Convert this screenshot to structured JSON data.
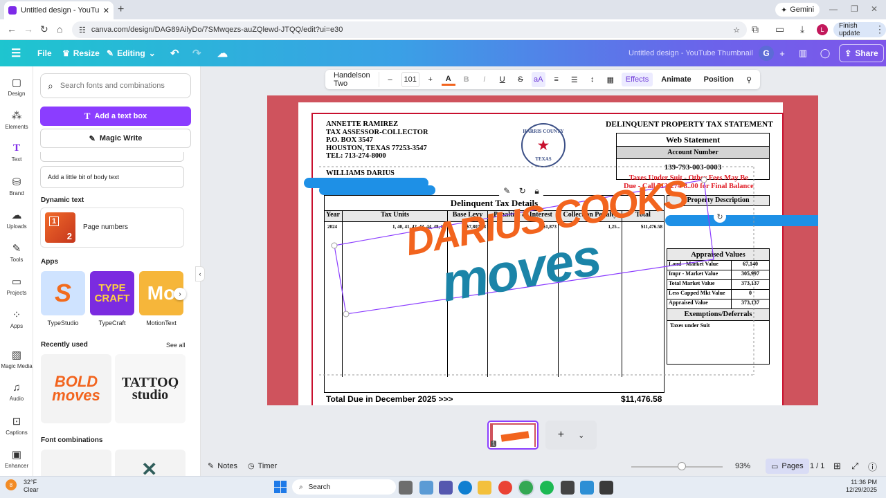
{
  "browser": {
    "tab_title": "Untitled design - YouTube Thum",
    "new_tab": "+",
    "gemini": "Gemini",
    "url": "canva.com/design/DAG89AilyDo/7SMwqezs-auZQlewd-JTQQ/edit?ui=e30",
    "finish_update": "Finish update",
    "profile_initial": "L"
  },
  "canva_header": {
    "file": "File",
    "resize": "Resize",
    "editing": "Editing",
    "doc_title": "Untitled design - YouTube Thumbnail",
    "avatar": "G",
    "share": "Share"
  },
  "rail": {
    "items": [
      {
        "label": "Design",
        "icon": "design-icon"
      },
      {
        "label": "Elements",
        "icon": "elements-icon"
      },
      {
        "label": "Text",
        "icon": "text-icon"
      },
      {
        "label": "Brand",
        "icon": "brand-icon"
      },
      {
        "label": "Uploads",
        "icon": "uploads-icon"
      },
      {
        "label": "Tools",
        "icon": "tools-icon"
      },
      {
        "label": "Projects",
        "icon": "projects-icon"
      },
      {
        "label": "Apps",
        "icon": "apps-icon"
      },
      {
        "label": "Magic Media",
        "icon": "magic-media-icon"
      },
      {
        "label": "Audio",
        "icon": "audio-icon"
      },
      {
        "label": "Captions",
        "icon": "captions-icon"
      },
      {
        "label": "Enhancer",
        "icon": "enhancer-icon"
      }
    ]
  },
  "panel": {
    "search_placeholder": "Search fonts and combinations",
    "add_text_box": "Add a text box",
    "magic_write": "Magic Write",
    "body_text": "Add a little bit of body text",
    "dynamic_text": "Dynamic text",
    "page_numbers": "Page numbers",
    "page_numbers_thumb": [
      "1",
      "2"
    ],
    "apps_heading": "Apps",
    "apps": [
      {
        "label": "TypeStudio",
        "thumb": "S"
      },
      {
        "label": "TypeCraft",
        "thumb": "TYPE CRAFT"
      },
      {
        "label": "MotionText",
        "thumb": "Mo"
      }
    ],
    "recently_used": "Recently used",
    "see_all": "See all",
    "recent": [
      "BOLD moves",
      "TATTOO studio"
    ],
    "font_combinations": "Font combinations"
  },
  "toolbar": {
    "font": "Handelson Two",
    "minus": "–",
    "size": "101",
    "plus": "+",
    "color_glyph": "A",
    "bold": "B",
    "italic": "I",
    "underline": "U",
    "strike": "S",
    "case": "aA",
    "effects": "Effects",
    "animate": "Animate",
    "position": "Position"
  },
  "document": {
    "assessor": [
      "ANNETTE RAMIREZ",
      "TAX ASSESSOR-COLLECTOR",
      "P.O. BOX 3547",
      "HOUSTON, TEXAS 77253-3547",
      "TEL: 713-274-8000"
    ],
    "seal_top": "HARRIS COUNTY",
    "seal_bottom": "TEXAS",
    "statement_title": "DELINQUENT PROPERTY TAX STATEMENT",
    "web_statement": "Web Statement",
    "account_number_label": "Account Number",
    "account_number": "139-793-003-0003",
    "owner": "WILLIAMS DARIUS",
    "suit_notice_1": "Taxes Under Suit - Other Fees May Be",
    "suit_notice_2": "Due - Call 713-274-8..00 for Final Balance",
    "details_title": "Delinquent Tax Details",
    "columns": [
      "Year",
      "Tax Units",
      "Base Levy",
      "Penalties & Interest",
      "Collection Penalty",
      "Total"
    ],
    "row": [
      "2024",
      "1, 40, 41, 42, 43, 44, 48, 61",
      "$7,807.38",
      "$1,873",
      "1,25...",
      "$11,476.58"
    ],
    "property_description": "Property Description",
    "appraised_values": "Appraised Values",
    "appraised": [
      {
        "label": "Land - Market Value",
        "value": "67,140"
      },
      {
        "label": "Impr - Market Value",
        "value": "305,997"
      },
      {
        "label": "Total Market Value",
        "value": "373,137"
      },
      {
        "label": "Less Capped Mkt Value",
        "value": "0"
      },
      {
        "label": "Appraised Value",
        "value": "373,137"
      }
    ],
    "exemptions": "Exemptions/Deferrals",
    "exemption_item": "Taxes under Suit",
    "total_due_label": "Total Due in December 2025 >>>",
    "total_due": "$11,476.58",
    "overlay_line1": "DARIUS COOKS",
    "overlay_line2": "moves"
  },
  "pages": {
    "thumb_number": "1",
    "add": "+"
  },
  "footer": {
    "notes": "Notes",
    "timer": "Timer",
    "zoom": "93%",
    "zoom_level": 0.55,
    "pages": "Pages",
    "page_count": "1 / 1"
  },
  "taskbar": {
    "weather_temp": "32°F",
    "weather_text": "Clear",
    "search": "Search",
    "time": "11:36 PM",
    "date": "12/29/2025",
    "badge": "8"
  },
  "colors": {
    "canva_purple": "#8b3dff",
    "header_start": "#1ec5cf",
    "header_end": "#7e56ea",
    "stage_bg": "#cf535d",
    "overlay_orange": "#f2641e",
    "overlay_teal": "#1b84a8",
    "scribble_blue": "#1e90e6"
  }
}
